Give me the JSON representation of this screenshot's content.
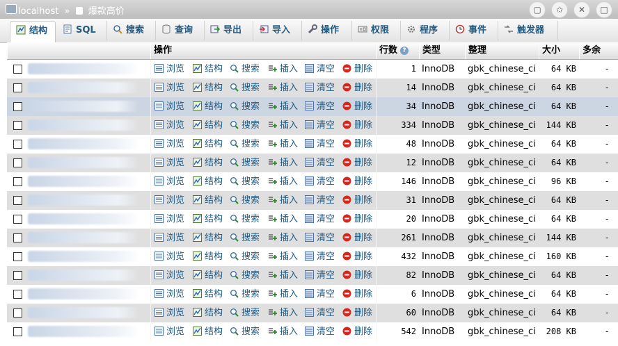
{
  "titlebar": {
    "host": "localhost",
    "separator": "»",
    "database": "爆款高价",
    "buttons": [
      "shirt-icon",
      "pin-icon",
      "close-icon",
      "restore-icon"
    ]
  },
  "tabs": [
    {
      "label": "结构",
      "icon": "structure-icon",
      "active": true
    },
    {
      "label": "SQL",
      "icon": "sql-icon",
      "active": false
    },
    {
      "label": "搜索",
      "icon": "search-icon",
      "active": false
    },
    {
      "label": "查询",
      "icon": "query-icon",
      "active": false
    },
    {
      "label": "导出",
      "icon": "export-icon",
      "active": false
    },
    {
      "label": "导入",
      "icon": "import-icon",
      "active": false
    },
    {
      "label": "操作",
      "icon": "wrench-icon",
      "active": false
    },
    {
      "label": "权限",
      "icon": "privileges-icon",
      "active": false
    },
    {
      "label": "程序",
      "icon": "routines-icon",
      "active": false
    },
    {
      "label": "事件",
      "icon": "clock-icon",
      "active": false
    },
    {
      "label": "触发器",
      "icon": "trigger-icon",
      "active": false
    }
  ],
  "table_header": {
    "actions": "操作",
    "rows": "行数",
    "type": "类型",
    "collation": "整理",
    "size": "大小",
    "overhead": "多余"
  },
  "actions": [
    "浏览",
    "结构",
    "搜索",
    "插入",
    "清空",
    "删除"
  ],
  "rows": [
    {
      "rows": "1",
      "type": "InnoDB",
      "collation": "gbk_chinese_ci",
      "size": "64 KB",
      "overhead": "-"
    },
    {
      "rows": "14",
      "type": "InnoDB",
      "collation": "gbk_chinese_ci",
      "size": "64 KB",
      "overhead": "-"
    },
    {
      "rows": "34",
      "type": "InnoDB",
      "collation": "gbk_chinese_ci",
      "size": "64 KB",
      "overhead": "-"
    },
    {
      "rows": "334",
      "type": "InnoDB",
      "collation": "gbk_chinese_ci",
      "size": "144 KB",
      "overhead": "-"
    },
    {
      "rows": "48",
      "type": "InnoDB",
      "collation": "gbk_chinese_ci",
      "size": "64 KB",
      "overhead": "-"
    },
    {
      "rows": "12",
      "type": "InnoDB",
      "collation": "gbk_chinese_ci",
      "size": "64 KB",
      "overhead": "-"
    },
    {
      "rows": "146",
      "type": "InnoDB",
      "collation": "gbk_chinese_ci",
      "size": "96 KB",
      "overhead": "-"
    },
    {
      "rows": "31",
      "type": "InnoDB",
      "collation": "gbk_chinese_ci",
      "size": "64 KB",
      "overhead": "-"
    },
    {
      "rows": "20",
      "type": "InnoDB",
      "collation": "gbk_chinese_ci",
      "size": "64 KB",
      "overhead": "-"
    },
    {
      "rows": "261",
      "type": "InnoDB",
      "collation": "gbk_chinese_ci",
      "size": "144 KB",
      "overhead": "-"
    },
    {
      "rows": "432",
      "type": "InnoDB",
      "collation": "gbk_chinese_ci",
      "size": "160 KB",
      "overhead": "-"
    },
    {
      "rows": "82",
      "type": "InnoDB",
      "collation": "gbk_chinese_ci",
      "size": "64 KB",
      "overhead": "-"
    },
    {
      "rows": "6",
      "type": "InnoDB",
      "collation": "gbk_chinese_ci",
      "size": "64 KB",
      "overhead": "-"
    },
    {
      "rows": "60",
      "type": "InnoDB",
      "collation": "gbk_chinese_ci",
      "size": "64 KB",
      "overhead": "-"
    },
    {
      "rows": "542",
      "type": "InnoDB",
      "collation": "gbk_chinese_ci",
      "size": "208 KB",
      "overhead": "-"
    }
  ],
  "colors": {
    "link": "#235a81",
    "row_even": "#dfdfdf",
    "row_highlight": "#ccd5e2",
    "delete_red": "#d9261c"
  }
}
